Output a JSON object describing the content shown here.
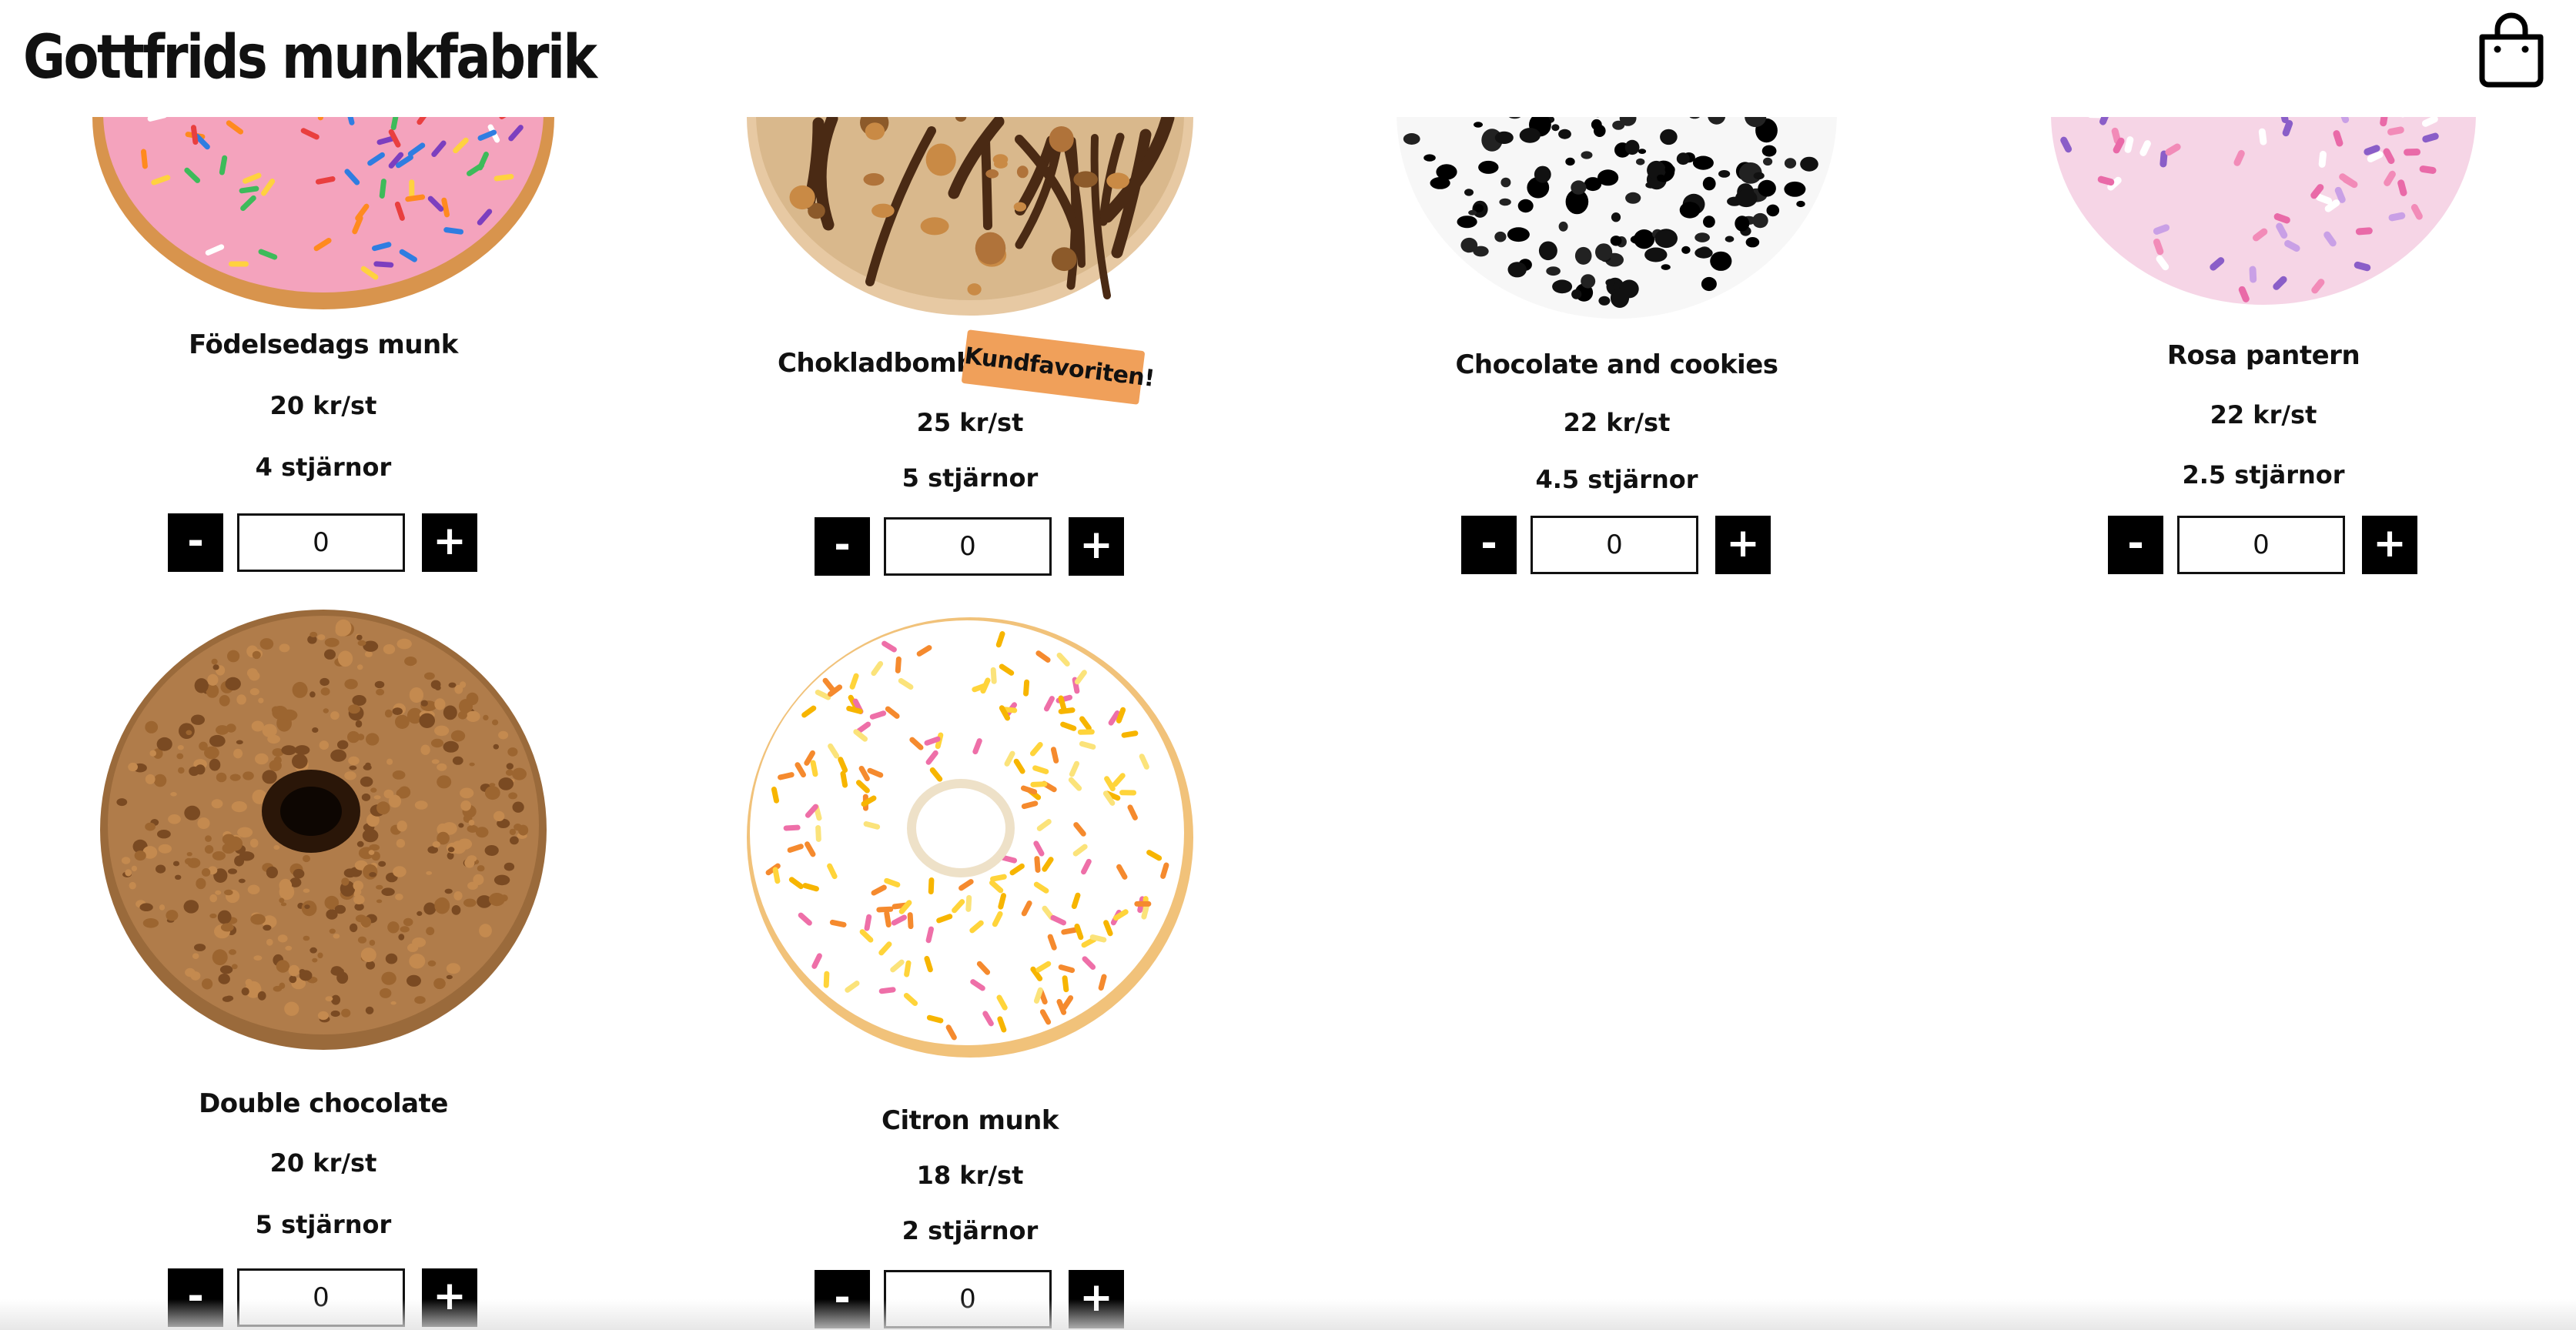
{
  "header": {
    "title": "Gottfrids munkfabrik",
    "cart_icon": "shopping-bag-icon"
  },
  "products": [
    {
      "name": "Födelsedags munk",
      "price": "20 kr/st",
      "rating": "4 stjärnor",
      "quantity": "0",
      "glaze": "#f4a3bd",
      "topping": "sprinkles"
    },
    {
      "name": "Chokladbomb",
      "price": "25 kr/st",
      "rating": "5 stjärnor",
      "quantity": "0",
      "glaze": "#d9b88c",
      "topping": "chocolate-drizzle",
      "badge": "Kundfavoriten!"
    },
    {
      "name": "Chocolate and cookies",
      "price": "22 kr/st",
      "rating": "4.5 stjärnor",
      "quantity": "0",
      "glaze": "#ffffff",
      "topping": "cookie-crumbs"
    },
    {
      "name": "Rosa pantern",
      "price": "22 kr/st",
      "rating": "2.5 stjärnor",
      "quantity": "0",
      "glaze": "#f6d5e6",
      "topping": "pink-sprinkles"
    },
    {
      "name": "Double chocolate",
      "price": "20 kr/st",
      "rating": "5 stjärnor",
      "quantity": "0",
      "glaze": "#b07c4a",
      "topping": "nut-crumbs"
    },
    {
      "name": "Citron munk",
      "price": "18 kr/st",
      "rating": "2 stjärnor",
      "quantity": "0",
      "glaze": "#ffffff",
      "topping": "yellow-sprinkles"
    }
  ],
  "controls": {
    "decrement_label": "-",
    "increment_label": "+"
  },
  "colors": {
    "badge": "#f0a05a",
    "button": "#000000"
  }
}
